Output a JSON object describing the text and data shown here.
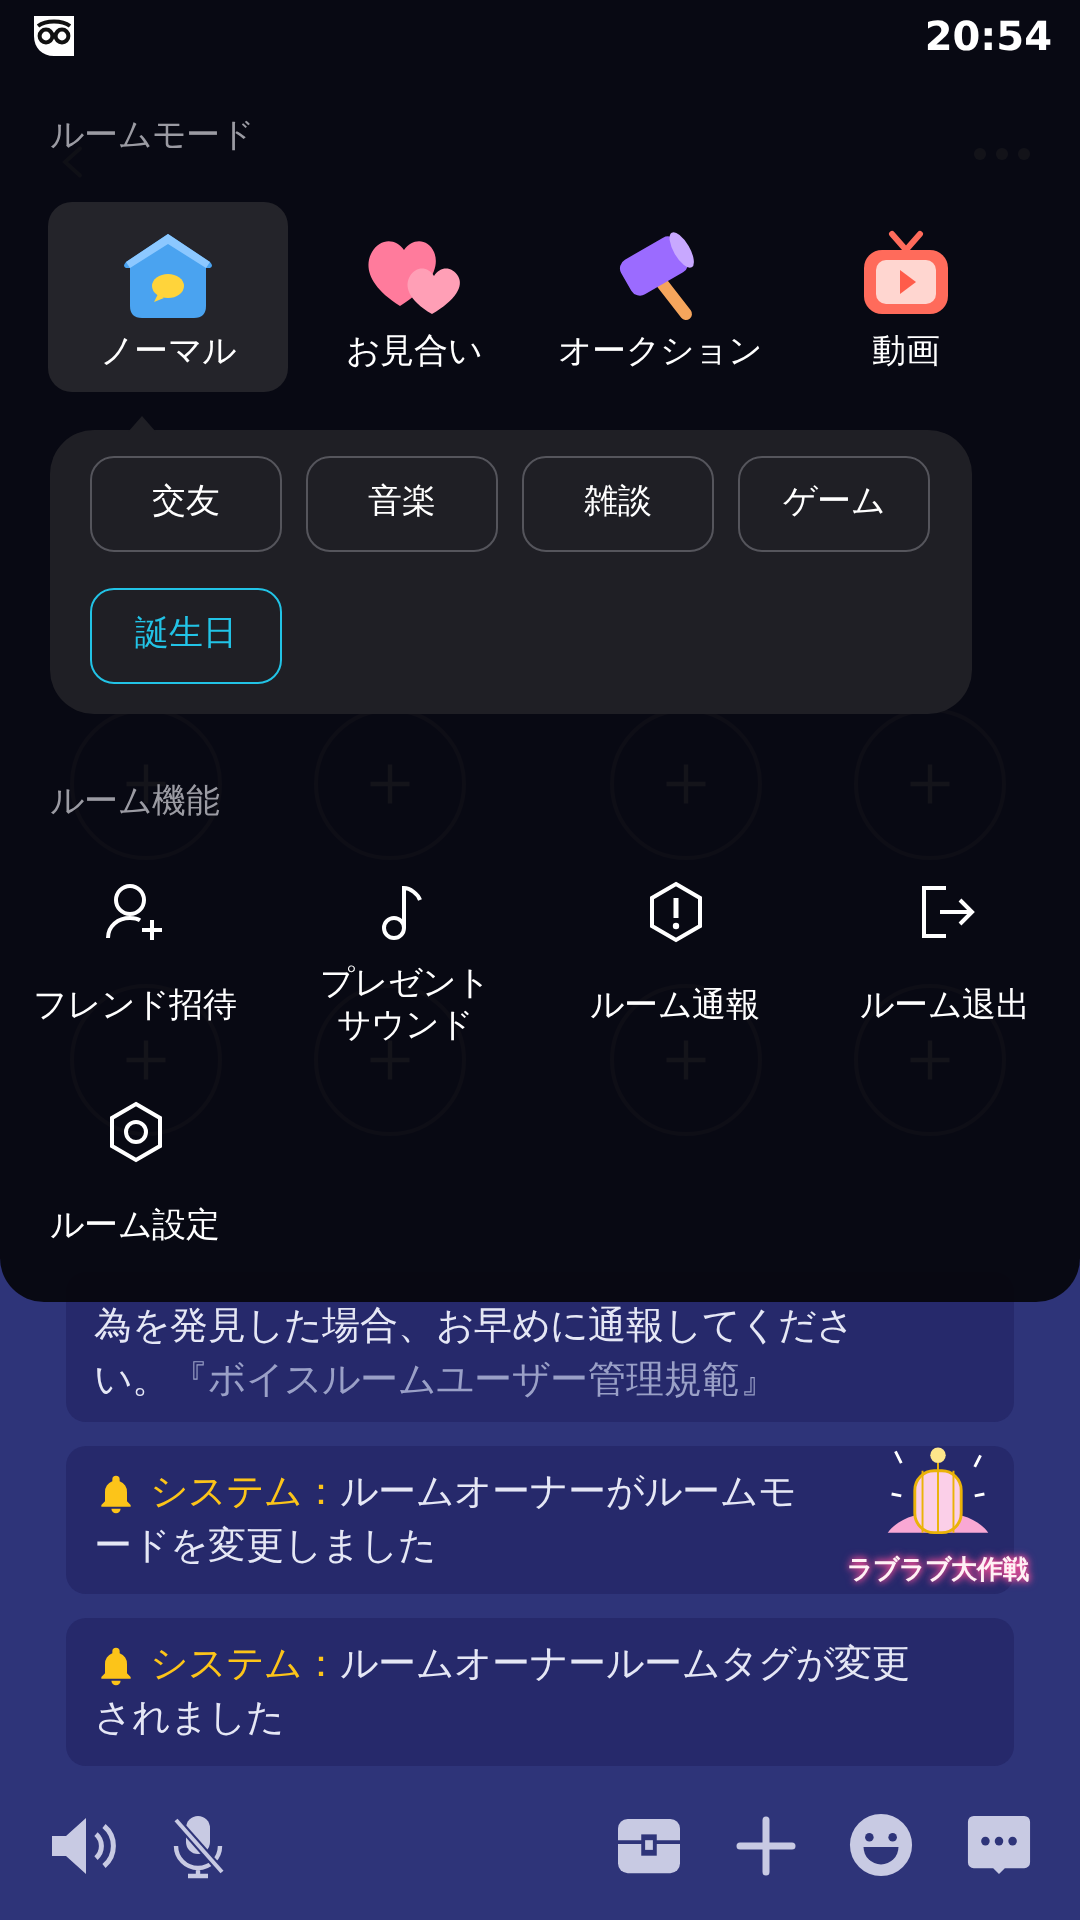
{
  "status_bar": {
    "time": "20:54"
  },
  "room_mode_sheet": {
    "heading": "ルームモード",
    "modes": [
      {
        "label": "ノーマル",
        "selected": true
      },
      {
        "label": "お見合い",
        "selected": false
      },
      {
        "label": "オークション",
        "selected": false
      },
      {
        "label": "動画",
        "selected": false
      }
    ],
    "tags": [
      {
        "label": "交友",
        "selected": false
      },
      {
        "label": "音楽",
        "selected": false
      },
      {
        "label": "雑談",
        "selected": false
      },
      {
        "label": "ゲーム",
        "selected": false
      },
      {
        "label": "誕生日",
        "selected": true
      }
    ],
    "functions_heading": "ルーム機能",
    "functions": [
      {
        "label": "フレンド招待"
      },
      {
        "label": "プレゼントサウンド"
      },
      {
        "label": "ルーム通報"
      },
      {
        "label": "ルーム退出"
      },
      {
        "label": "ルーム設定"
      }
    ]
  },
  "chat": {
    "messages": [
      {
        "kind": "notice",
        "lines": [
          "為を発見した場合、お早めに通報してくださ",
          "い。"
        ],
        "link": "『ボイスルームユーザー管理規範』"
      },
      {
        "kind": "system",
        "sender": "システム：",
        "text": "ルームオーナーがルームモードを変更しました"
      },
      {
        "kind": "system",
        "sender": "システム：",
        "text": "ルームオーナールームタグが変更されました"
      }
    ]
  },
  "event_badge": {
    "label": "ラブラブ大作戦"
  }
}
